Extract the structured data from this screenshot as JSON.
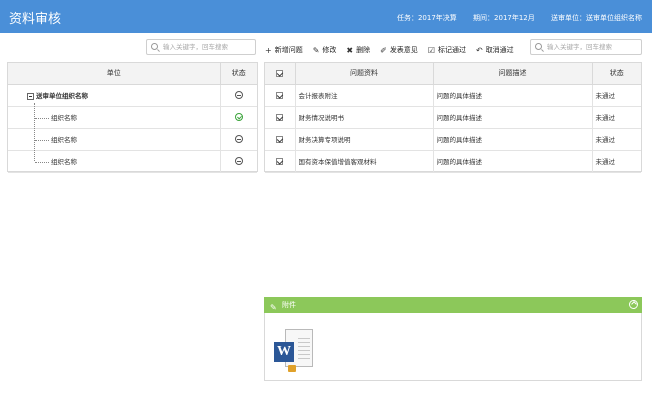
{
  "header": {
    "title": "资料审核",
    "task": "任务：2017年决算",
    "period": "期间：2017年12月",
    "unit": "送审单位：送审单位组织名称"
  },
  "left_search": {
    "placeholder": "输入关键字，回车搜索"
  },
  "right_search": {
    "placeholder": "输入关键字，回车搜索"
  },
  "toolbar": [
    {
      "icon": "+",
      "label": "新增问题"
    },
    {
      "icon": "✎",
      "label": "修改"
    },
    {
      "icon": "✖",
      "label": "删除"
    },
    {
      "icon": "✐",
      "label": "发表意见"
    },
    {
      "icon": "☑",
      "label": "标记通过"
    },
    {
      "icon": "↶",
      "label": "取消通过"
    }
  ],
  "tree": {
    "col_unit": "单位",
    "col_status": "状态",
    "root": {
      "label": "送审单位组织名称",
      "status": "minus"
    },
    "children": [
      {
        "label": "组织名称",
        "status": "ok"
      },
      {
        "label": "组织名称",
        "status": "minus"
      },
      {
        "label": "组织名称",
        "status": "minus"
      }
    ]
  },
  "issues": {
    "col_material": "问题资料",
    "col_desc": "问题描述",
    "col_status": "状态",
    "rows": [
      {
        "material": "会计报表附注",
        "desc": "问题的具体描述",
        "status": "未通过",
        "checked": true
      },
      {
        "material": "财务情况说明书",
        "desc": "问题的具体描述",
        "status": "未通过",
        "checked": true
      },
      {
        "material": "财务决算专项说明",
        "desc": "问题的具体描述",
        "status": "未通过",
        "checked": true
      },
      {
        "material": "国有资本保值增值客观材料",
        "desc": "问题的具体描述",
        "status": "未通过",
        "checked": true
      }
    ]
  },
  "attachment": {
    "title": "附件",
    "file_icon": "word-document-icon",
    "badge_letter": "W"
  },
  "colors": {
    "header": "#4a8fd8",
    "attach_bar": "#8cc85a",
    "ok": "#3aa33a"
  }
}
